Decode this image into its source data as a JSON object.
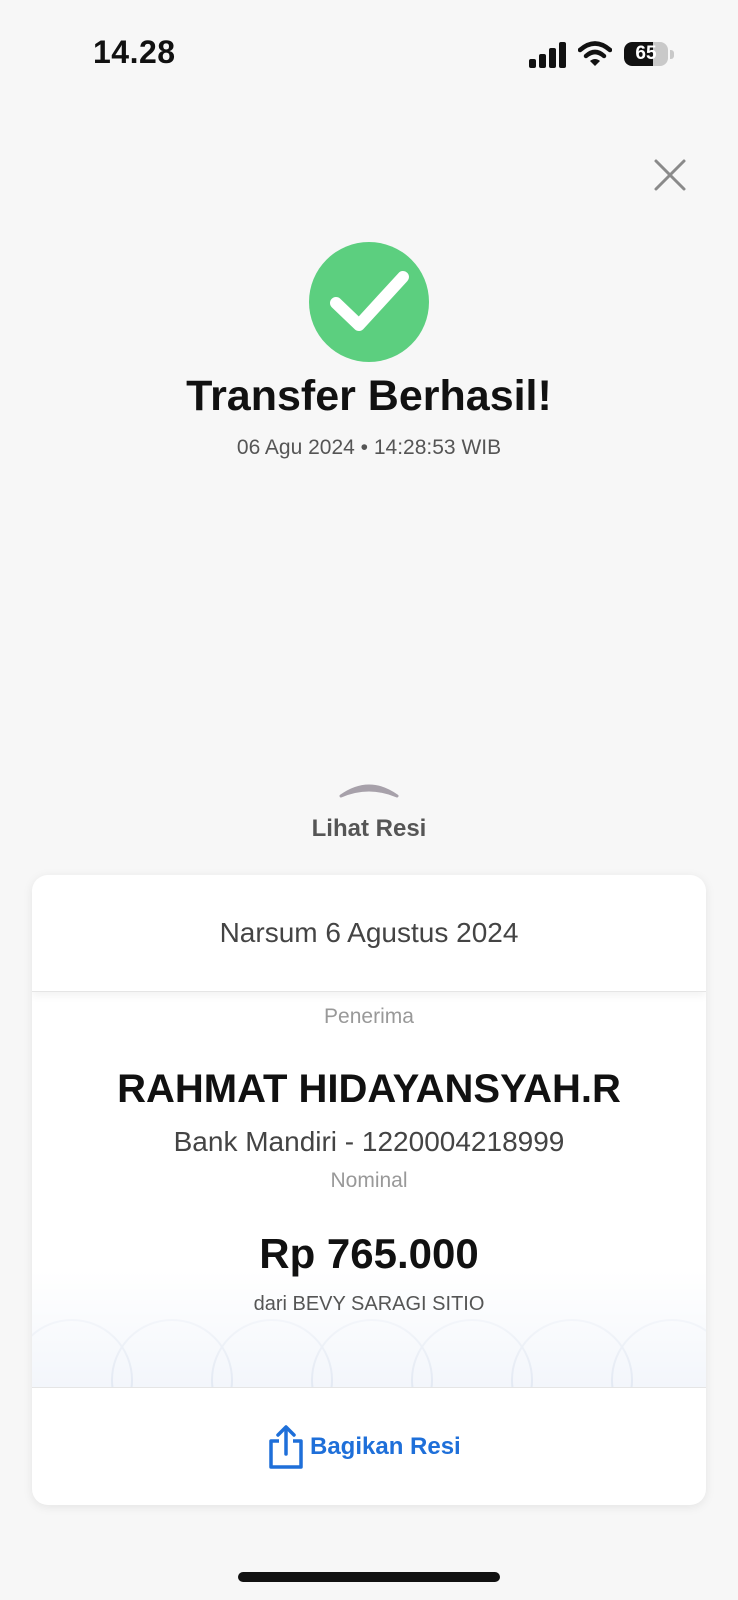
{
  "status_bar": {
    "time": "14.28",
    "battery_level": "65",
    "icons": [
      "signal-icon",
      "wifi-icon",
      "battery-icon"
    ]
  },
  "header": {
    "close_icon": "close-icon"
  },
  "result": {
    "icon": "check-circle-icon",
    "title": "Transfer Berhasil!",
    "datetime": "06 Agu 2024 • 14:28:53 WIB"
  },
  "receipt_toggle": {
    "icon": "chevron-up-icon",
    "label": "Lihat Resi"
  },
  "receipt": {
    "note": "Narsum 6 Agustus 2024",
    "recipient_label": "Penerima",
    "recipient_name": "RAHMAT HIDAYANSYAH.R",
    "bank_account": "Bank Mandiri - 1220004218999",
    "amount_label": "Nominal",
    "amount": "Rp 765.000",
    "sender": "dari BEVY SARAGI SITIO",
    "share_icon": "share-icon",
    "share_label": "Bagikan Resi"
  },
  "colors": {
    "success": "#5ccf7f",
    "accent": "#1e6fd9",
    "background": "#f7f7f7"
  }
}
